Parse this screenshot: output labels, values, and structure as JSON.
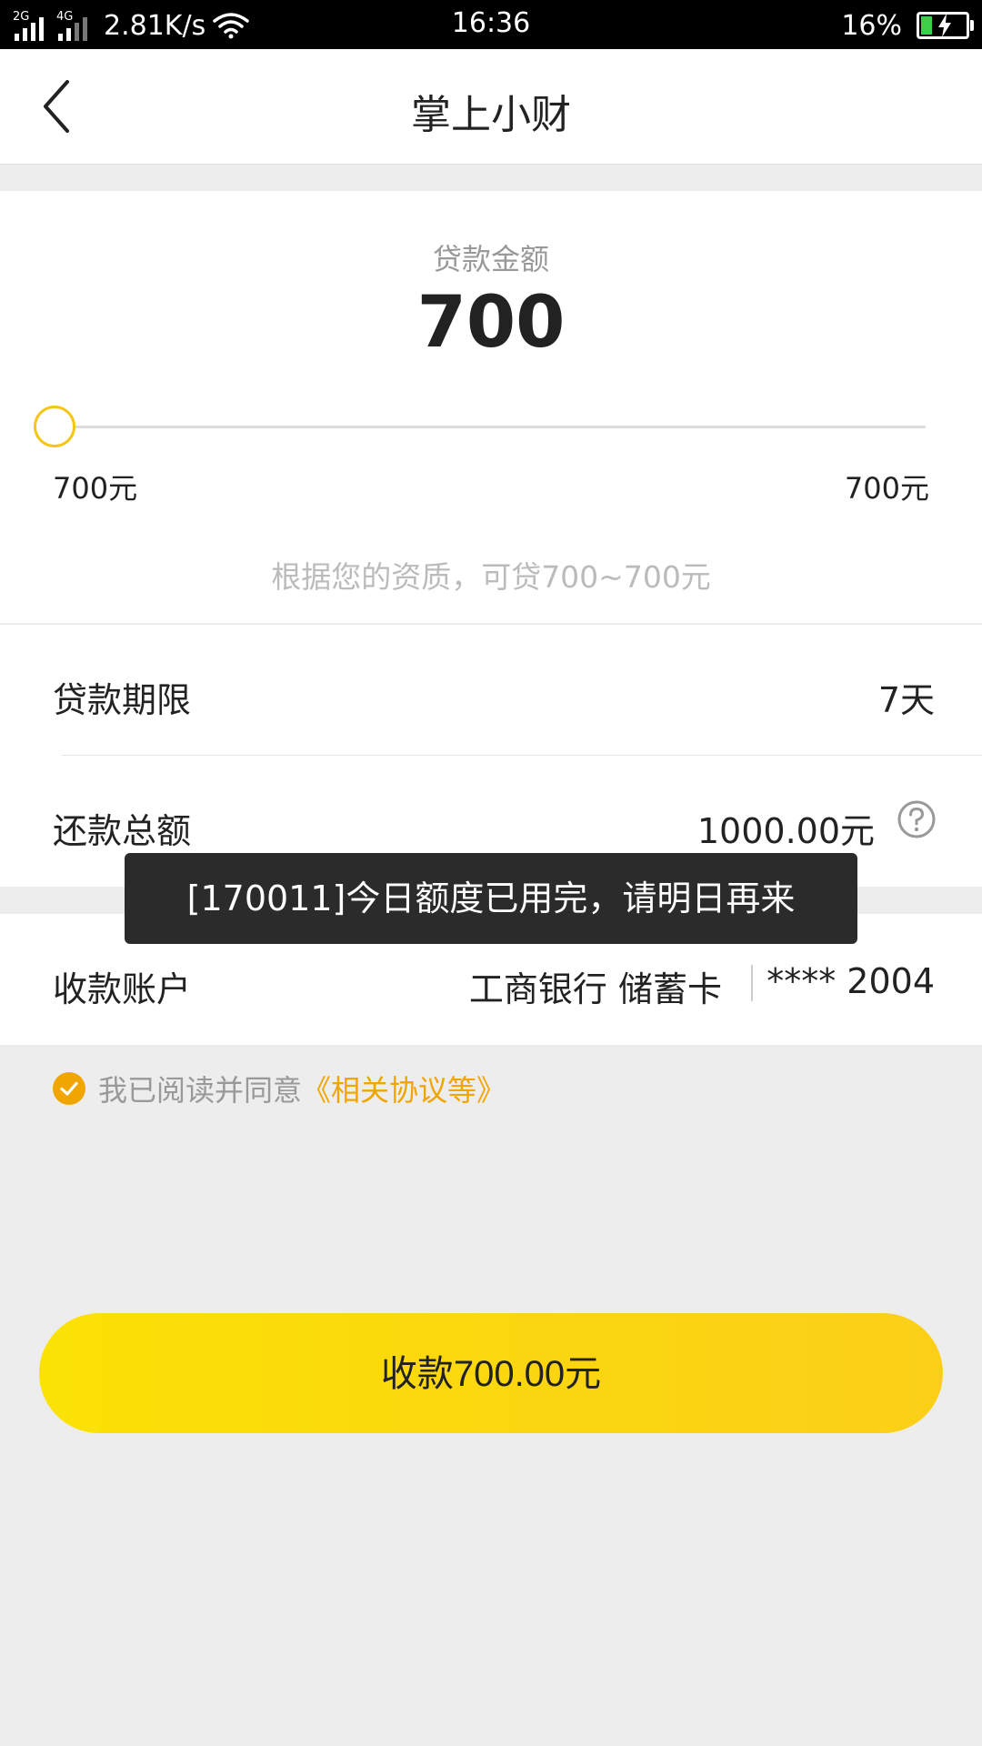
{
  "status_bar": {
    "sim1": "2G",
    "sim2": "4G",
    "speed": "2.81K/s",
    "time": "16:36",
    "battery": "16%"
  },
  "nav": {
    "title": "掌上小财"
  },
  "loan": {
    "amount_label": "贷款金额",
    "amount_value": "700",
    "slider_min_label": "700元",
    "slider_max_label": "700元",
    "slider_fraction": 0,
    "hint": "根据您的资质，可贷700~700元"
  },
  "term": {
    "label": "贷款期限",
    "value": "7天"
  },
  "repay": {
    "label": "还款总额",
    "value": "1000.00元"
  },
  "account": {
    "label": "收款账户",
    "bank": "工商银行 储蓄卡",
    "number": "**** 2004"
  },
  "agreement": {
    "text": "我已阅读并同意",
    "link": "《相关协议等》",
    "checked": true
  },
  "submit": {
    "label": "收款700.00元"
  },
  "toast": {
    "message": "[170011]今日额度已用完，请明日再来"
  },
  "colors": {
    "accent": "#f5c518",
    "link": "#f0a500",
    "button_start": "#fbe205",
    "button_end": "#fbcf18",
    "toast_bg": "#2b2b2b"
  }
}
